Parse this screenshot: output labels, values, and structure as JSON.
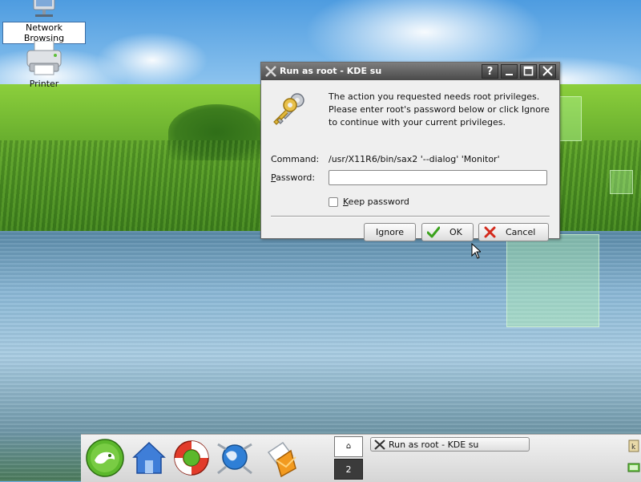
{
  "desktop": {
    "icons": [
      {
        "label": "Network Browsing",
        "selected": true
      },
      {
        "label": "Printer",
        "selected": false
      }
    ]
  },
  "dialog": {
    "title": "Run as root - KDE su",
    "titlebar_buttons": {
      "help": "?",
      "minimize": "_",
      "maximize": "□",
      "close": "✕"
    },
    "message": "The action you requested needs root privileges. Please enter root's password below or click Ignore to continue with your current privileges.",
    "message_lines": [
      "The action you requested needs root privileges.",
      "Please enter root's password below or click Ignore",
      "to continue with your current privileges."
    ],
    "command_label": "Command:",
    "command_value": "/usr/X11R6/bin/sax2 '--dialog' 'Monitor'",
    "password_label_first": "P",
    "password_label_rest": "assword:",
    "password_value": "",
    "keep_password_first": "K",
    "keep_password_rest": "eep password",
    "keep_password_checked": false,
    "buttons": {
      "ignore": "Ignore",
      "ok": "OK",
      "cancel": "Cancel"
    }
  },
  "taskbar": {
    "launchers": [
      "suse-menu-icon",
      "home-icon",
      "help-lifebuoy-icon",
      "konqueror-globe-icon",
      "kmail-icon"
    ],
    "pager": {
      "desktop_1": "⌂",
      "desktop_2": "2"
    },
    "tasks": [
      {
        "label": "Run as root - KDE su",
        "icon": "x-icon"
      }
    ]
  }
}
